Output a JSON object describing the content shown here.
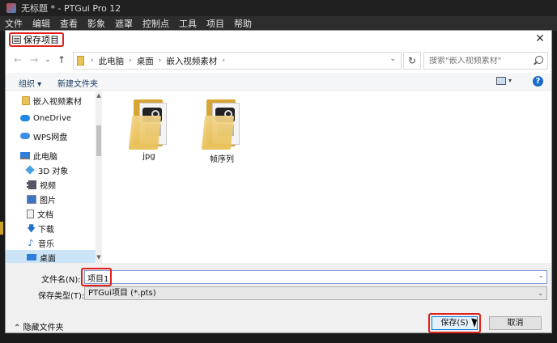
{
  "app": {
    "title": "无标题 * - PTGui Pro 12",
    "menu": [
      "文件",
      "编辑",
      "查看",
      "影象",
      "遮罩",
      "控制点",
      "工具",
      "项目",
      "帮助"
    ]
  },
  "dialog": {
    "title": "保存项目",
    "close_glyph": "✕"
  },
  "nav_buttons": {
    "back": "←",
    "forward": "→",
    "recent": "⌄",
    "up": "↑"
  },
  "address": {
    "crumbs": [
      "此电脑",
      "桌面",
      "嵌入视频素材"
    ],
    "separator": "›",
    "dropdown": "⌄",
    "refresh_glyph": "↻"
  },
  "search": {
    "placeholder": "搜索\"嵌入视频素材\""
  },
  "toolbar": {
    "organize": "组织 ▾",
    "new_folder": "新建文件夹",
    "help": "?"
  },
  "sidebar": {
    "items": [
      {
        "label": "嵌入视频素材"
      },
      {
        "label": "OneDrive"
      },
      {
        "label": "WPS网盘"
      },
      {
        "label": "此电脑"
      },
      {
        "label": "3D 对象"
      },
      {
        "label": "视频"
      },
      {
        "label": "图片"
      },
      {
        "label": "文档"
      },
      {
        "label": "下载"
      },
      {
        "label": "音乐"
      },
      {
        "label": "桌面"
      }
    ],
    "scroll_up": "▲",
    "scroll_down": "▼"
  },
  "files": [
    {
      "name": "jpg"
    },
    {
      "name": "帧序列"
    }
  ],
  "form": {
    "filename_label": "文件名(N):",
    "filename_value": "项目1",
    "filetype_label": "保存类型(T):",
    "filetype_value": "PTGui项目 (*.pts)",
    "dropdown": "⌄"
  },
  "footer": {
    "hide_folders": "⌃ 隐藏文件夹",
    "save": "保存(S)",
    "cancel": "取消"
  },
  "colors": {
    "highlight": "#e0201b",
    "accent": "#0078d7",
    "selection": "#cce4f7"
  }
}
